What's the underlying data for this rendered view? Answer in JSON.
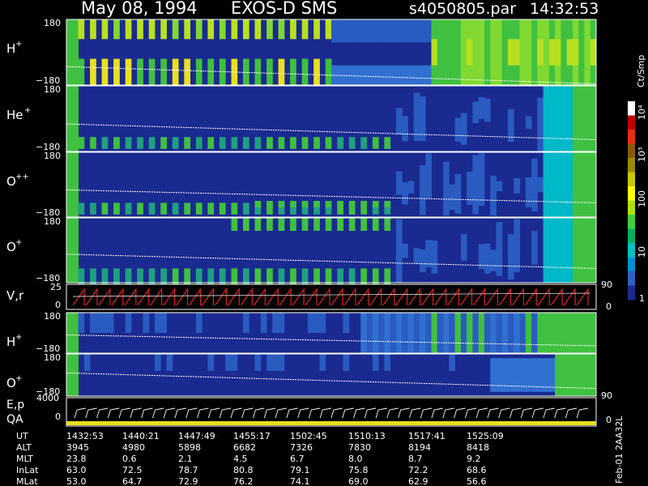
{
  "header": {
    "date": "May 08, 1994",
    "instrument": "EXOS-D SMS",
    "file": "s4050805.par",
    "time": "14:32:53"
  },
  "chart_data": {
    "type": "heatmap",
    "panels": [
      {
        "label": "H",
        "sup": "+",
        "ylim": [
          -180,
          180
        ],
        "top_tick": "180",
        "bottom_tick": "−180",
        "trace_from": 0.72,
        "trace_to": 0.98,
        "pattern": "H"
      },
      {
        "label": "He",
        "sup": "+",
        "ylim": [
          -180,
          180
        ],
        "top_tick": "180",
        "bottom_tick": "−180",
        "trace_from": 0.58,
        "trace_to": 0.82,
        "pattern": "He"
      },
      {
        "label": "O",
        "sup": "++",
        "ylim": [
          -180,
          180
        ],
        "top_tick": "180",
        "bottom_tick": "−180",
        "trace_from": 0.58,
        "trace_to": 0.78,
        "pattern": "Opp"
      },
      {
        "label": "O",
        "sup": "+",
        "ylim": [
          -180,
          180
        ],
        "top_tick": "180",
        "bottom_tick": "−180",
        "trace_from": 0.56,
        "trace_to": 0.78,
        "pattern": "Op"
      },
      {
        "label": "H",
        "sup": "+",
        "ylim": [
          -180,
          180
        ],
        "top_tick": "180",
        "bottom_tick": "−180",
        "trace_from": 0.55,
        "trace_to": 0.82,
        "pattern": "H2"
      },
      {
        "label": "O",
        "sup": "+",
        "ylim": [
          -180,
          180
        ],
        "top_tick": "180",
        "bottom_tick": "−180",
        "trace_from": 0.45,
        "trace_to": 0.82,
        "pattern": "O2"
      }
    ],
    "velocity_panel": {
      "label": "V,r",
      "left_ticks": [
        "25",
        "0"
      ],
      "right_ticks": [
        "90",
        "0"
      ]
    },
    "energy_panel": {
      "label": "E,p",
      "label2": "QA",
      "left_ticks": [
        "4000",
        "0"
      ],
      "right_ticks": [
        "90",
        "0"
      ]
    },
    "colorbar": {
      "unit": "Ct/Smp",
      "scale": "log",
      "tick_labels": [
        "10⁴",
        "10³",
        "100",
        "10",
        "1"
      ],
      "colors": [
        "#ffffff",
        "#c00000",
        "#e83010",
        "#8a5a00",
        "#9a8a00",
        "#c8c800",
        "#ffff00",
        "#b0e000",
        "#40d040",
        "#00b060",
        "#00c0c0",
        "#0090d0",
        "#3060c0",
        "#1a2a90"
      ]
    },
    "x_axis": {
      "rows": [
        {
          "name": "UT",
          "values": [
            "1432:53",
            "1440:21",
            "1447:49",
            "1455:17",
            "1502:45",
            "1510:13",
            "1517:41",
            "1525:09"
          ]
        },
        {
          "name": "ALT",
          "values": [
            "3945",
            "4980",
            "5898",
            "6682",
            "7326",
            "7830",
            "8194",
            "8418"
          ]
        },
        {
          "name": "MLT",
          "values": [
            "23.8",
            "0.6",
            "2.1",
            "4.5",
            "6.7",
            "8.0",
            "8.7",
            "9.2"
          ]
        },
        {
          "name": "InLat",
          "values": [
            "63.0",
            "72.5",
            "78.7",
            "80.8",
            "79.1",
            "75.8",
            "72.2",
            "68.6"
          ]
        },
        {
          "name": "MLat",
          "values": [
            "53.0",
            "64.7",
            "72.9",
            "76.2",
            "74.1",
            "69.0",
            "62.9",
            "56.6"
          ]
        }
      ]
    },
    "footer_stamp": "Feb-01 2AA32L"
  }
}
